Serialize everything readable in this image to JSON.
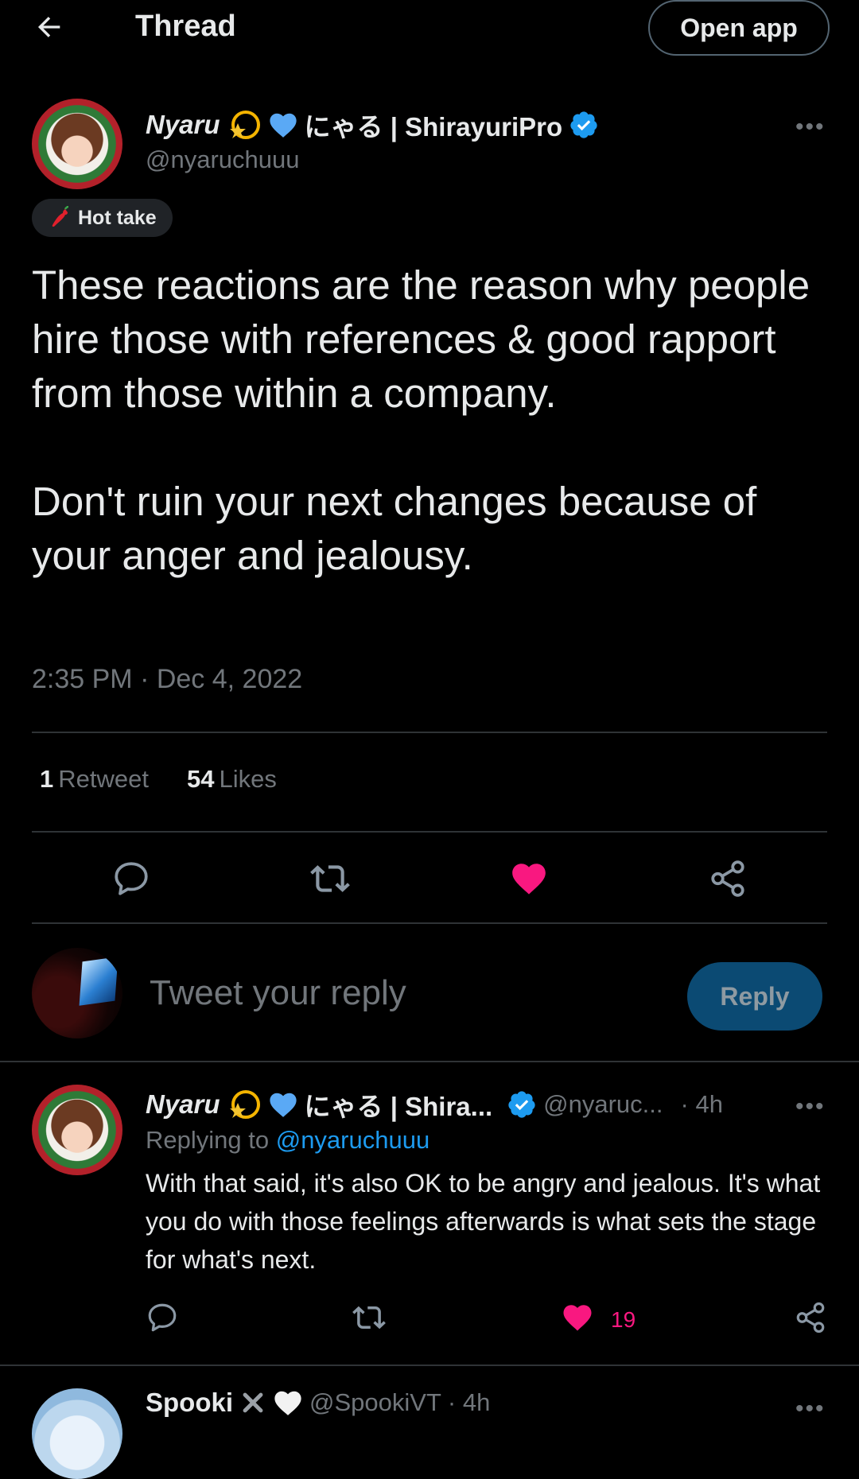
{
  "header": {
    "title": "Thread",
    "open_app_label": "Open app"
  },
  "main_tweet": {
    "display_name": "Nyaru",
    "display_name_suffix": "にゃる | ShirayuriPro",
    "handle": "@nyaruchuuu",
    "badge_label": "Hot take",
    "text": "These reactions are the reason why people hire those with references & good rapport from those within a company.\n\nDon't ruin your next changes because of your anger and jealousy.",
    "timestamp": "2:35 PM · Dec 4, 2022",
    "retweet_count": "1",
    "retweet_label": "Retweet",
    "like_count": "54",
    "like_label": "Likes",
    "liked": true
  },
  "composer": {
    "placeholder": "Tweet your reply",
    "reply_label": "Reply"
  },
  "reply_tweet": {
    "display_name": "Nyaru",
    "display_name_suffix": "にゃる | Shira...",
    "handle": "@nyaruc...",
    "time": "· 4h",
    "replying_prefix": "Replying to ",
    "replying_handle": "@nyaruchuuu",
    "text": "With that said, it's also OK to be angry and jealous. It's what you do with those feelings afterwards is what sets the stage for what's next.",
    "like_count": "19",
    "liked": true
  },
  "next_tweet": {
    "display_name": "Spooki",
    "handle": "@SpookiVT",
    "time": "· 4h"
  },
  "icons": {
    "back": "arrow-left-icon",
    "more": "more-horizontal-icon",
    "verified": "verified-badge-icon",
    "reply": "reply-icon",
    "retweet": "retweet-icon",
    "like": "heart-icon",
    "share": "share-icon",
    "pepper": "chili-pepper-icon"
  },
  "colors": {
    "background": "#000000",
    "accent": "#1d9bf0",
    "like": "#f91880",
    "muted": "#71767b",
    "divider": "#2f3336"
  }
}
